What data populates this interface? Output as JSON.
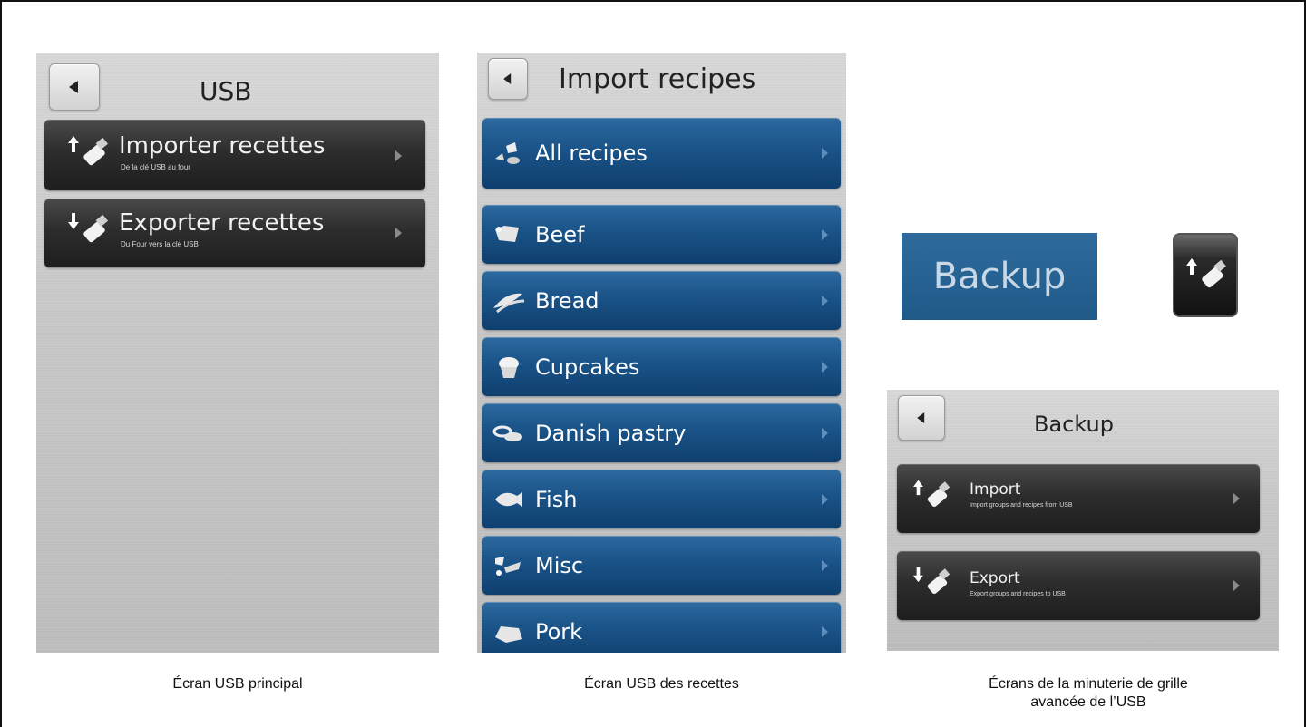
{
  "panel_usb": {
    "title": "USB",
    "buttons": [
      {
        "label": "Importer recettes",
        "subtitle": "De la clé USB au four",
        "icon": "usb-import-icon"
      },
      {
        "label": "Exporter recettes",
        "subtitle": "Du Four vers la clé USB",
        "icon": "usb-export-icon"
      }
    ],
    "caption": "Écran USB principal"
  },
  "panel_import": {
    "title": "Import recipes",
    "items": [
      {
        "label": "All recipes",
        "icon": "all-recipes-icon"
      },
      {
        "label": "Beef",
        "icon": "beef-icon"
      },
      {
        "label": "Bread",
        "icon": "bread-icon"
      },
      {
        "label": "Cupcakes",
        "icon": "cupcake-icon"
      },
      {
        "label": "Danish pastry",
        "icon": "danish-pastry-icon"
      },
      {
        "label": "Fish",
        "icon": "fish-icon"
      },
      {
        "label": "Misc",
        "icon": "misc-icon"
      },
      {
        "label": "Pork",
        "icon": "pork-icon"
      }
    ],
    "caption": "Écran USB des recettes"
  },
  "panel_backup": {
    "backup_button_label": "Backup",
    "title": "Backup",
    "buttons": [
      {
        "label": "Import",
        "subtitle": "Import groups and recipes from USB",
        "icon": "usb-import-icon"
      },
      {
        "label": "Export",
        "subtitle": "Export groups and recipes to USB",
        "icon": "usb-export-icon"
      }
    ],
    "caption_line1": "Écrans de la minuterie de grille",
    "caption_line2": "avancée de l’USB"
  },
  "colors": {
    "blue_button": "#1b558a",
    "dark_button": "#2d2d2d",
    "panel_bg": "#c9c9c9"
  }
}
